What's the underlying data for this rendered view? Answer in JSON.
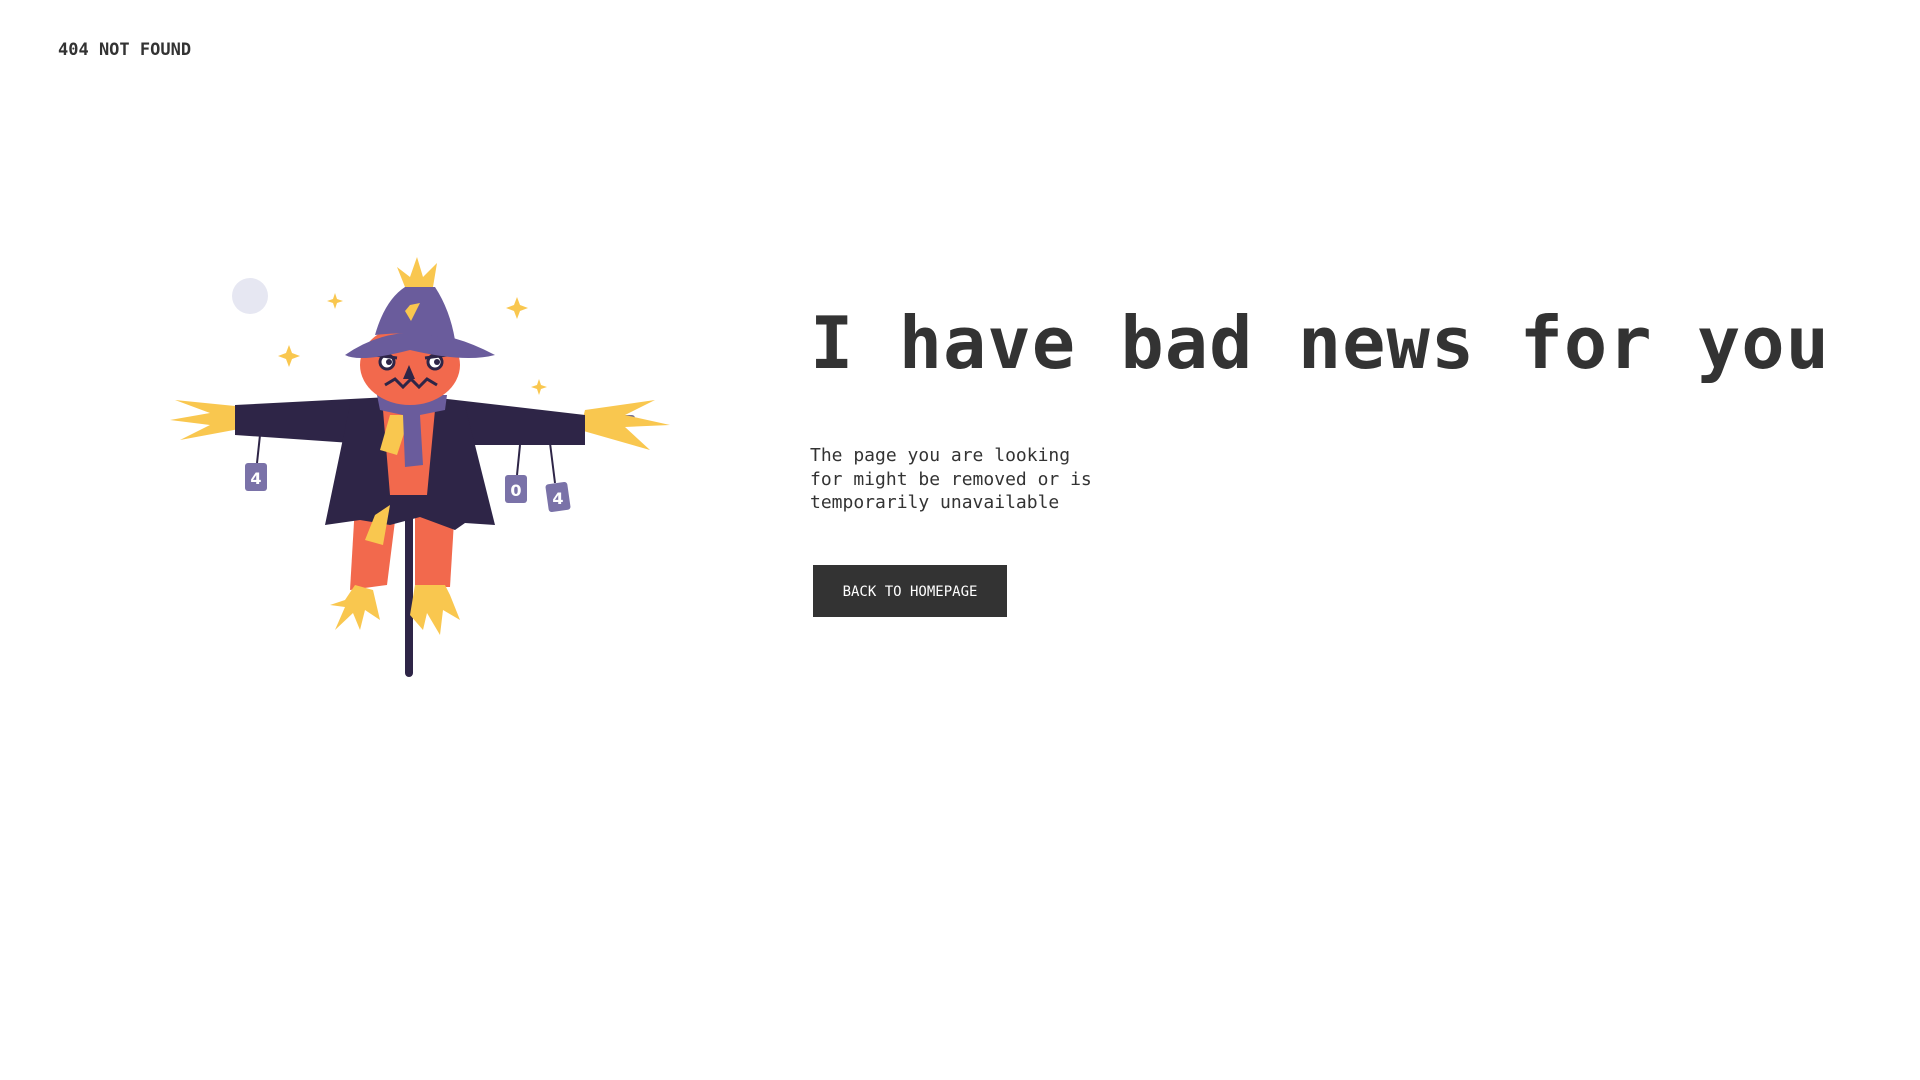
{
  "header": {
    "title": "404 NOT FOUND"
  },
  "main": {
    "headline": "I have bad news for you",
    "message": "The page you are looking for might be removed or is temporarily unavailable",
    "back_button_label": "BACK TO HOMEPAGE"
  },
  "illustration": {
    "can_labels": [
      "4",
      "0",
      "4"
    ]
  },
  "colors": {
    "text": "#333333",
    "button_bg": "#333333",
    "button_text": "#ffffff",
    "coat": "#2e2547",
    "hat": "#6a5c9c",
    "face": "#f2694d",
    "straw": "#f9c74f",
    "moon": "#e6e7f2"
  }
}
